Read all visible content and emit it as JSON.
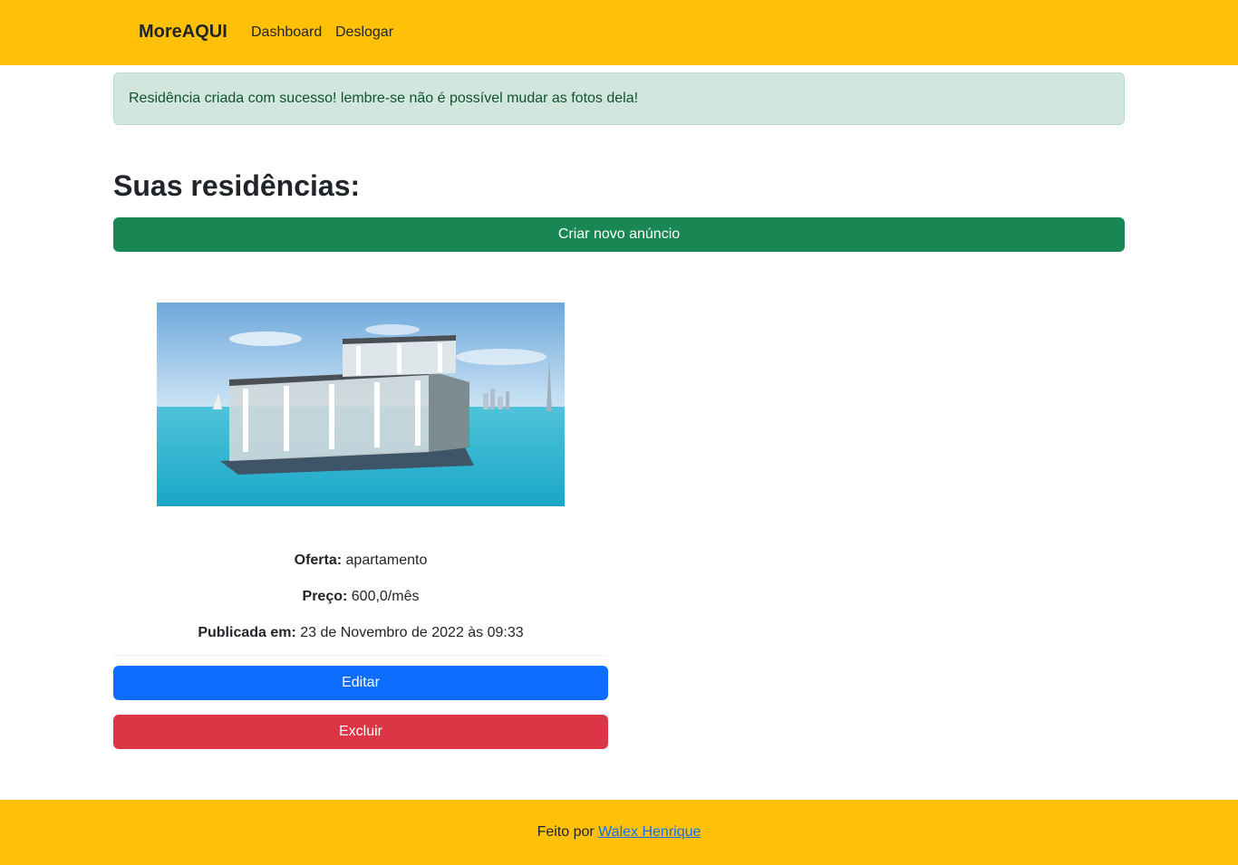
{
  "navbar": {
    "brand": "MoreAQUI",
    "links": [
      {
        "label": "Dashboard"
      },
      {
        "label": "Deslogar"
      }
    ]
  },
  "alert": {
    "message": "Residência criada com sucesso! lembre-se não é possível mudar as fotos dela!"
  },
  "main": {
    "title": "Suas residências:",
    "create_button": "Criar novo anúncio"
  },
  "listing": {
    "offer_label": "Oferta:",
    "offer_value": "apartamento",
    "price_label": "Preço:",
    "price_value": "600,0/mês",
    "published_label": "Publicada em:",
    "published_value": "23 de Novembro de 2022 às 09:33",
    "edit_button": "Editar",
    "delete_button": "Excluir"
  },
  "footer": {
    "text": "Feito por",
    "author_link": "Walex Henrique"
  },
  "colors": {
    "primary_yellow": "#ffc107",
    "success": "#198754",
    "primary": "#0d6efd",
    "danger": "#dc3545",
    "alert_bg": "#d1e7dd"
  }
}
